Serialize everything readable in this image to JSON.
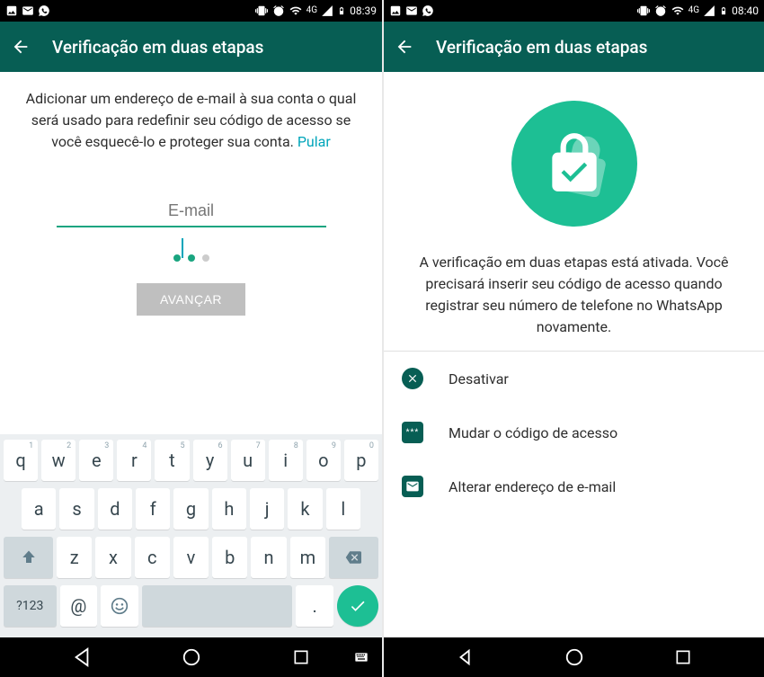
{
  "screen1": {
    "statusbar": {
      "time": "08:39",
      "net": "4G"
    },
    "appbar": {
      "title": "Verificação em duas etapas"
    },
    "description": "Adicionar um endereço de e-mail à sua conta o qual será usado para redefinir seu código de acesso se você esquecê-lo e proteger sua conta. ",
    "skip": "Pular",
    "email_placeholder": "E-mail",
    "advance": "AVANÇAR",
    "keyboard": {
      "row1": [
        "q",
        "w",
        "e",
        "r",
        "t",
        "y",
        "u",
        "i",
        "o",
        "p"
      ],
      "row1nums": [
        "1",
        "2",
        "3",
        "4",
        "5",
        "6",
        "7",
        "8",
        "9",
        "0"
      ],
      "row2": [
        "a",
        "s",
        "d",
        "f",
        "g",
        "h",
        "j",
        "k",
        "l"
      ],
      "row3": [
        "z",
        "x",
        "c",
        "v",
        "b",
        "n",
        "m"
      ],
      "sym": "?123",
      "at": "@",
      "dot": "."
    }
  },
  "screen2": {
    "statusbar": {
      "time": "08:40",
      "net": "4G"
    },
    "appbar": {
      "title": "Verificação em duas etapas"
    },
    "message": "A verificação em duas etapas está ativada. Você precisará inserir seu código de acesso quando registrar seu número de telefone no WhatsApp novamente.",
    "options": {
      "disable": "Desativar",
      "change_code": "Mudar o código de acesso",
      "change_email": "Alterar endereço de e-mail"
    }
  }
}
